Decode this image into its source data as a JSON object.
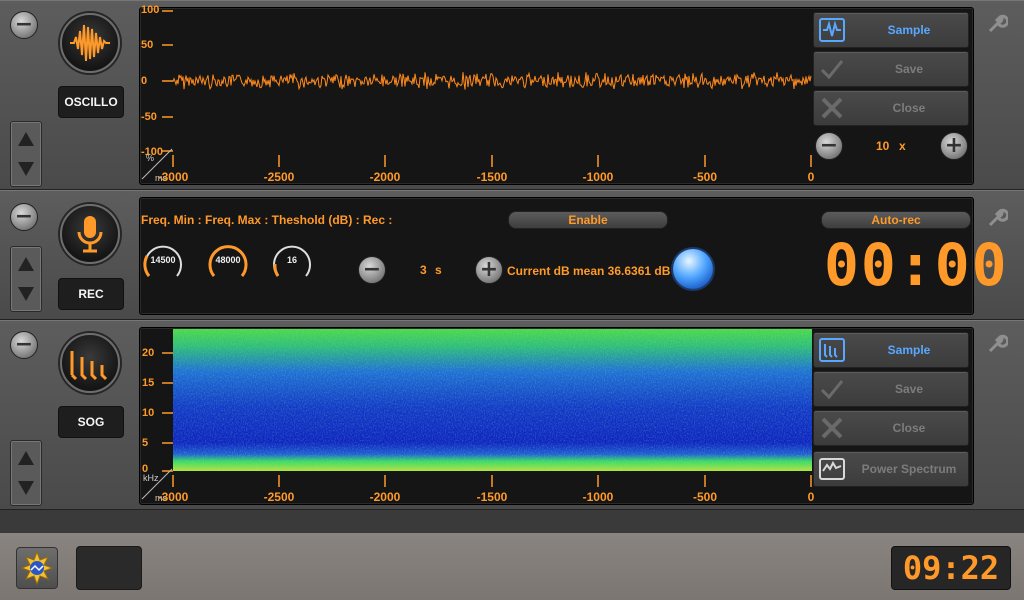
{
  "oscillo": {
    "label": "OSCILLO",
    "y_ticks": [
      "100",
      "50",
      "0",
      "-50",
      "-100"
    ],
    "x_ticks": [
      "-3000",
      "-2500",
      "-2000",
      "-1500",
      "-1000",
      "-500",
      "0"
    ],
    "unit_y": "%",
    "unit_x": "ms",
    "buttons": {
      "sample": "Sample",
      "save": "Save",
      "close": "Close"
    },
    "zoom_value": "10",
    "zoom_unit": "x",
    "wave_color": "#ff8a1c"
  },
  "rec": {
    "label": "REC",
    "header": "Freq. Min :  Freq. Max : Theshold (dB) : Rec :",
    "freq_min": "14500",
    "freq_max": "48000",
    "threshold": "16",
    "rec_value": "3",
    "rec_unit": "s",
    "enable_label": "Enable",
    "autorec_label": "Auto-rec",
    "db_mean_text": "Current dB mean 36.6361 dB",
    "timer": "00:00"
  },
  "sog": {
    "label": "SOG",
    "y_ticks": [
      "20",
      "15",
      "10",
      "5",
      "0"
    ],
    "x_ticks": [
      "-3000",
      "-2500",
      "-2000",
      "-1500",
      "-1000",
      "-500",
      "0"
    ],
    "unit_y": "kHz",
    "unit_x": "ms",
    "buttons": {
      "sample": "Sample",
      "save": "Save",
      "close": "Close",
      "power": "Power Spectrum"
    }
  },
  "footer": {
    "clock": "09:22"
  },
  "colors": {
    "accent": "#ff9a2a",
    "active_blue": "#58a8ff"
  }
}
